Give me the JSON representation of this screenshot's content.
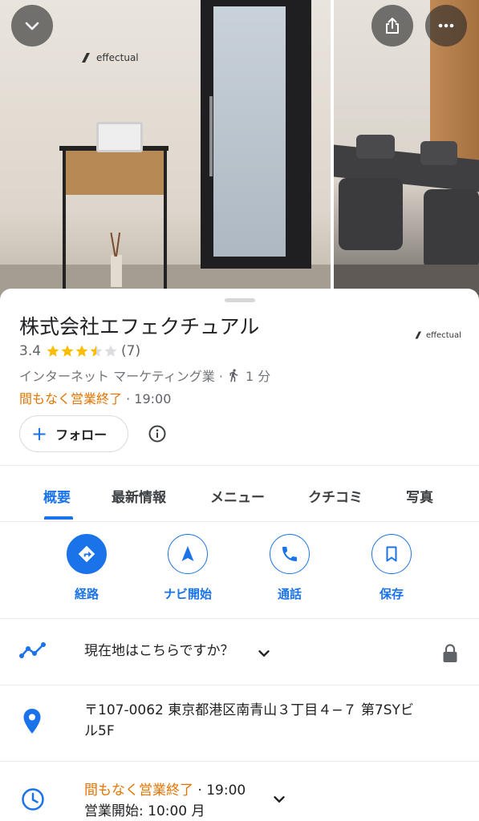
{
  "header": {
    "back_icon": "chevron-down-icon",
    "share_icon": "share-icon",
    "more_icon": "more-horiz-icon",
    "wall_logo_text": "effectual"
  },
  "place": {
    "name": "株式会社エフェクチュアル",
    "logo_text": "effectual",
    "rating": "3.4",
    "stars": 3.4,
    "review_count": "(7)",
    "category": "インターネット マーケティング業 ·",
    "walk_time": "1 分",
    "status": "間もなく営業終了",
    "status_sep_time": " · 19:00",
    "follow_label": "フォロー"
  },
  "tabs": [
    {
      "label": "概要",
      "active": true
    },
    {
      "label": "最新情報",
      "active": false
    },
    {
      "label": "メニュー",
      "active": false
    },
    {
      "label": "クチコミ",
      "active": false
    },
    {
      "label": "写真",
      "active": false
    }
  ],
  "actions": [
    {
      "label": "経路",
      "icon": "directions-icon"
    },
    {
      "label": "ナビ開始",
      "icon": "navigation-icon"
    },
    {
      "label": "通話",
      "icon": "phone-icon"
    },
    {
      "label": "保存",
      "icon": "bookmark-icon"
    }
  ],
  "rows": {
    "location_prompt": "現在地はこちらですか？",
    "address_line1": "〒107-0062 東京都港区南青山３丁目４−７ 第7SYビ",
    "address_line2": "ル5F",
    "hours_status": "間もなく営業終了",
    "hours_close": " · 19:00",
    "hours_open": "営業開始: 10:00 月"
  },
  "colors": {
    "accent": "#1a73e8",
    "status_orange": "#e37400",
    "star": "#fbbc04"
  }
}
